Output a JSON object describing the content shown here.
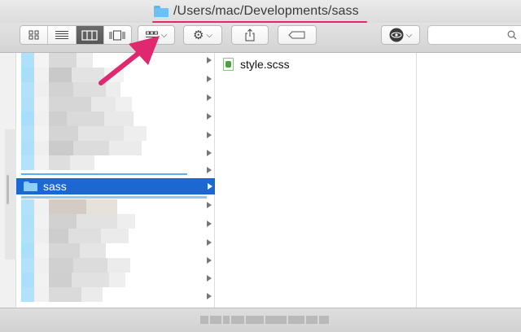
{
  "window": {
    "title": "/Users/mac/Developments/sass"
  },
  "toolbar": {
    "view_buttons": [
      {
        "name": "icon-view",
        "active": false
      },
      {
        "name": "list-view",
        "active": false
      },
      {
        "name": "column-view",
        "active": true
      },
      {
        "name": "cover-flow-view",
        "active": false
      }
    ],
    "arrange_icon": "arrange-icon",
    "action_icon": "gear-icon",
    "share_icon": "share-icon",
    "tag_icon": "tag-icon",
    "eye_icon": "eye-icon",
    "search_icon": "search-icon"
  },
  "browser": {
    "selected_folder": "sass",
    "file": "style.scss"
  },
  "colors": {
    "selection": "#1b68d2",
    "annotation": "#e0286e",
    "folder": "#6cc0f2"
  }
}
